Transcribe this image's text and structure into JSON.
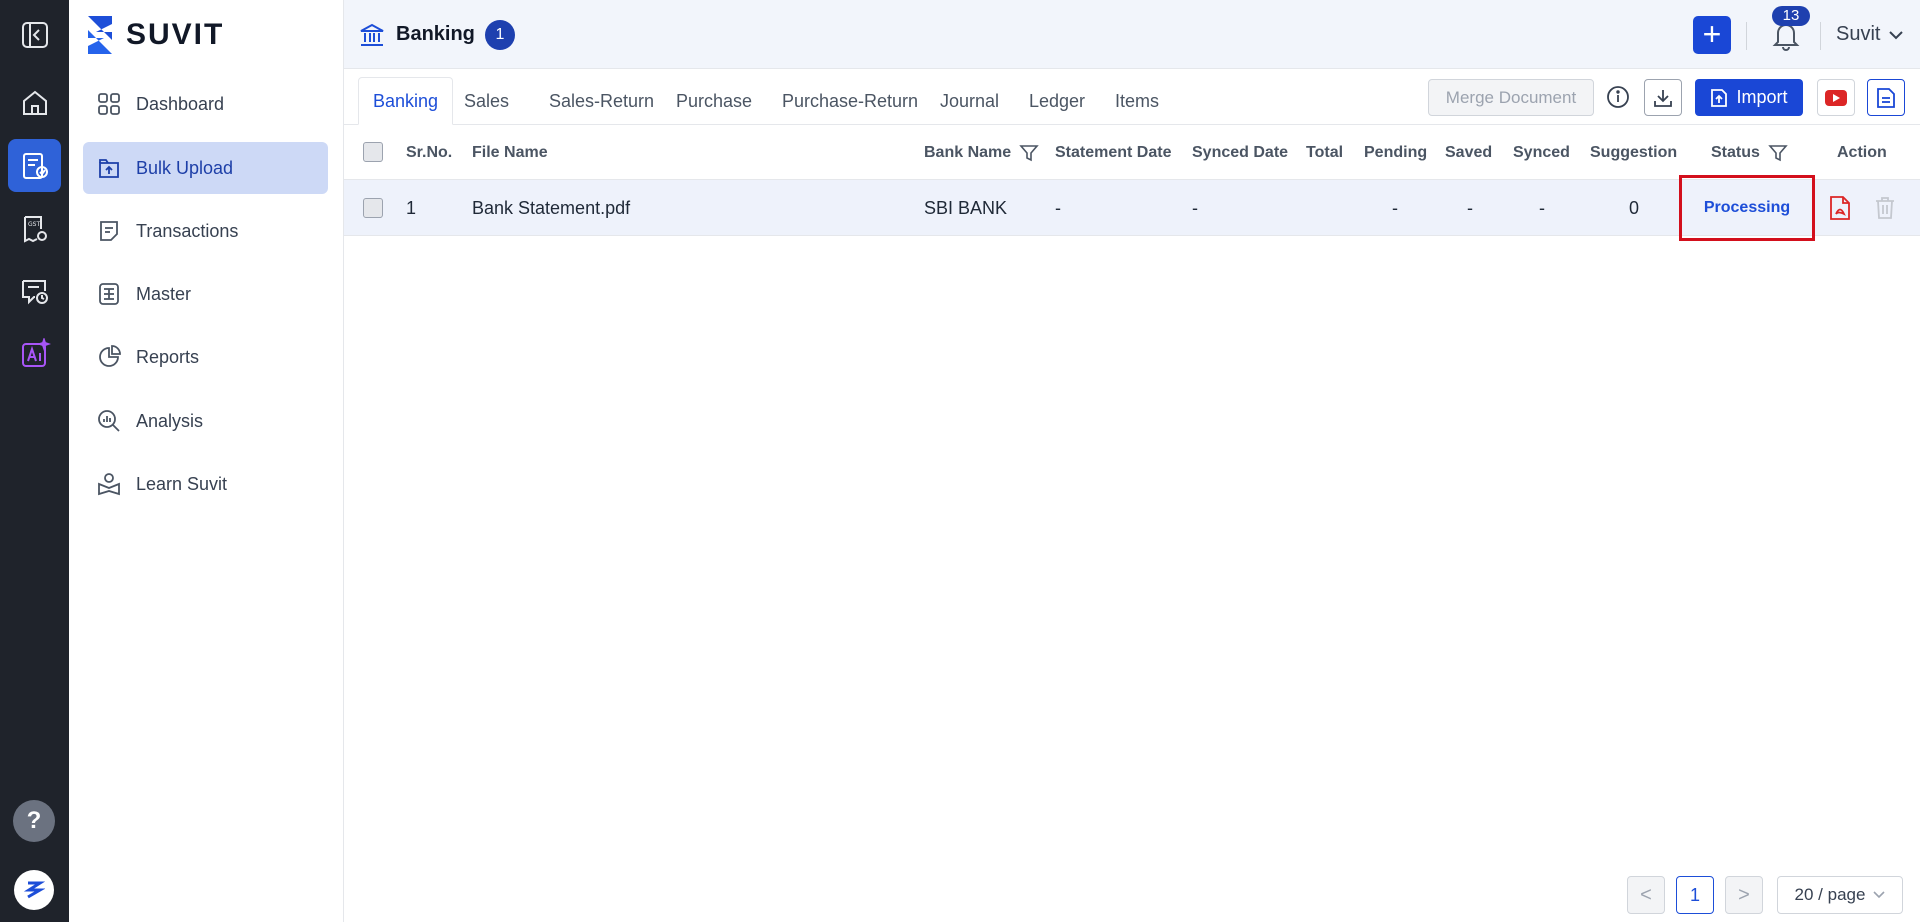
{
  "app": {
    "logo_text": "SUVIT"
  },
  "rail": {
    "items": [
      {
        "icon": "collapse-icon"
      },
      {
        "icon": "home-icon"
      },
      {
        "icon": "bulk-upload-icon",
        "active": true
      },
      {
        "icon": "gst-icon"
      },
      {
        "icon": "chat-clock-icon"
      },
      {
        "icon": "ai-icon"
      }
    ],
    "help_label": "?"
  },
  "sidebar": {
    "items": [
      {
        "label": "Dashboard",
        "icon": "dashboard-icon"
      },
      {
        "label": "Bulk Upload",
        "icon": "upload-icon",
        "active": true
      },
      {
        "label": "Transactions",
        "icon": "transactions-icon"
      },
      {
        "label": "Master",
        "icon": "master-icon"
      },
      {
        "label": "Reports",
        "icon": "reports-icon"
      },
      {
        "label": "Analysis",
        "icon": "analysis-icon"
      },
      {
        "label": "Learn Suvit",
        "icon": "learn-icon"
      }
    ]
  },
  "header": {
    "title": "Banking",
    "title_badge": "1",
    "notification_count": "13",
    "user_name": "Suvit"
  },
  "tabs": [
    {
      "label": "Banking",
      "active": true
    },
    {
      "label": "Sales"
    },
    {
      "label": "Sales-Return"
    },
    {
      "label": "Purchase"
    },
    {
      "label": "Purchase-Return"
    },
    {
      "label": "Journal"
    },
    {
      "label": "Ledger"
    },
    {
      "label": "Items"
    }
  ],
  "toolbar": {
    "merge_label": "Merge Document",
    "import_label": "Import"
  },
  "table": {
    "columns": {
      "srno": "Sr.No.",
      "file": "File Name",
      "bank": "Bank Name",
      "statement_date": "Statement Date",
      "synced_date": "Synced Date",
      "total": "Total",
      "pending": "Pending",
      "saved": "Saved",
      "synced": "Synced",
      "suggestion": "Suggestion",
      "status": "Status",
      "action": "Action"
    },
    "rows": [
      {
        "srno": "1",
        "file": "Bank Statement.pdf",
        "bank": "SBI BANK",
        "statement_date": "-",
        "synced_date": "-",
        "total": "",
        "pending": "-",
        "saved": "-",
        "synced": "-",
        "suggestion": "0",
        "status": "Processing"
      }
    ]
  },
  "pagination": {
    "prev": "<",
    "current": "1",
    "next": ">",
    "page_size": "20 / page"
  },
  "colors": {
    "accent": "#1a47d6",
    "highlight": "#d30f1c",
    "sidebar_active": "#cdd9f6",
    "rail": "#1f232b"
  }
}
